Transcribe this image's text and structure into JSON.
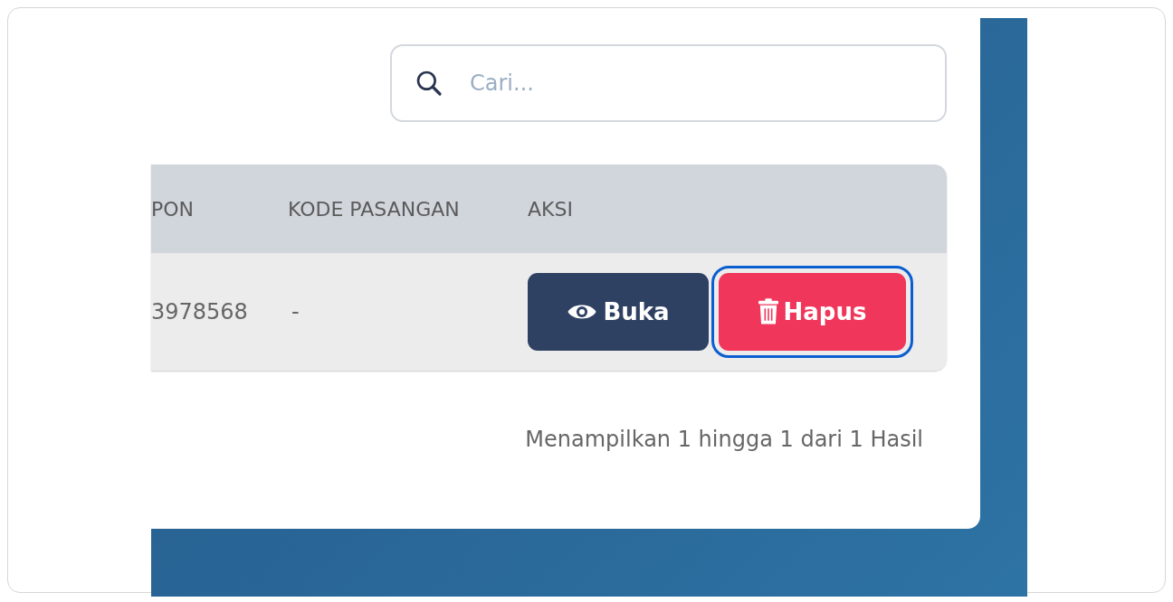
{
  "search": {
    "placeholder": "Cari..."
  },
  "table": {
    "columns": [
      "PON",
      "KODE PASANGAN",
      "AKSI"
    ],
    "rows": [
      {
        "cells": [
          "3978568",
          "-"
        ],
        "actions": [
          {
            "kind": "view",
            "label": "Buka",
            "focused": false
          },
          {
            "kind": "delete",
            "label": "Hapus",
            "focused": true
          }
        ]
      }
    ]
  },
  "footer": "Menampilkan 1 hingga 1 dari 1 Hasil"
}
